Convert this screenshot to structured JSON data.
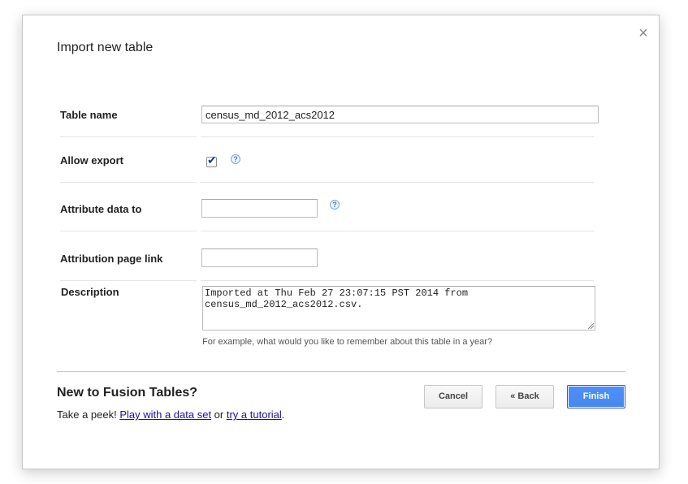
{
  "dialog": {
    "title": "Import new table",
    "close_glyph": "×"
  },
  "form": {
    "table_name": {
      "label": "Table name",
      "value": "census_md_2012_acs2012"
    },
    "allow_export": {
      "label": "Allow export",
      "checked": true,
      "help_glyph": "?"
    },
    "attribute_data_to": {
      "label": "Attribute data to",
      "value": "",
      "help_glyph": "?"
    },
    "attribution_page_link": {
      "label": "Attribution page link",
      "value": ""
    },
    "description": {
      "label": "Description",
      "value": "Imported at Thu Feb 27 23:07:15 PST 2014 from\ncensus_md_2012_acs2012.csv.",
      "hint": "For example, what would you like to remember about this table in a year?"
    }
  },
  "promo": {
    "title": "New to Fusion Tables?",
    "prefix": "Take a peek! ",
    "link1": "Play with a data set",
    "middle": " or ",
    "link2": "try a tutorial",
    "suffix": "."
  },
  "buttons": {
    "cancel": "Cancel",
    "back": "« Back",
    "finish": "Finish"
  },
  "colors": {
    "primary": "#4d90fe",
    "link": "#1a0dab"
  }
}
